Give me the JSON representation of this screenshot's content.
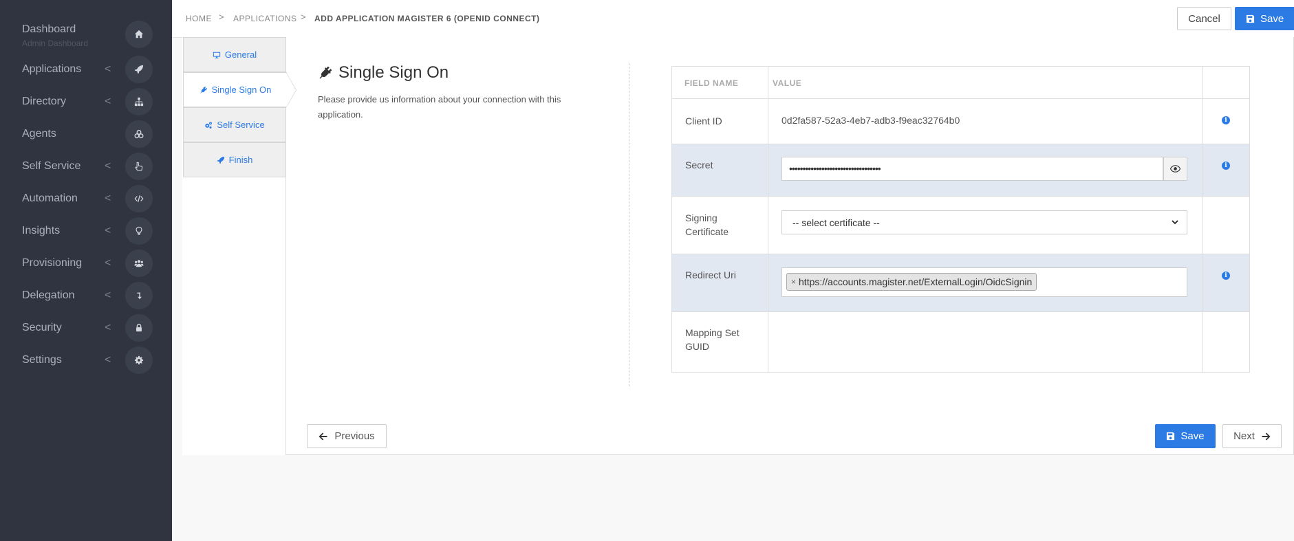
{
  "sidebar": {
    "items": [
      {
        "label": "Dashboard",
        "sublabel": "Admin Dashboard",
        "icon": "home-icon",
        "chevron": false
      },
      {
        "label": "Applications",
        "icon": "rocket-icon",
        "chevron": true
      },
      {
        "label": "Directory",
        "icon": "sitemap-icon",
        "chevron": true
      },
      {
        "label": "Agents",
        "icon": "cubes-icon",
        "chevron": false
      },
      {
        "label": "Self Service",
        "icon": "hand-pointer-icon",
        "chevron": true
      },
      {
        "label": "Automation",
        "icon": "code-icon",
        "chevron": true
      },
      {
        "label": "Insights",
        "icon": "lightbulb-icon",
        "chevron": true
      },
      {
        "label": "Provisioning",
        "icon": "users-icon",
        "chevron": true
      },
      {
        "label": "Delegation",
        "icon": "level-down-icon",
        "chevron": true
      },
      {
        "label": "Security",
        "icon": "lock-icon",
        "chevron": true
      },
      {
        "label": "Settings",
        "icon": "gear-icon",
        "chevron": true
      }
    ],
    "chevron_glyph": "<"
  },
  "breadcrumb": {
    "home": "HOME",
    "applications": "APPLICATIONS",
    "current": "ADD APPLICATION MAGISTER 6 (OPENID CONNECT)",
    "sep": ">"
  },
  "toolbar": {
    "cancel_label": "Cancel",
    "save_label": "Save"
  },
  "steps": [
    {
      "label": "General",
      "icon": "desktop-icon"
    },
    {
      "label": "Single Sign On",
      "icon": "plug-icon",
      "active": true
    },
    {
      "label": "Self Service",
      "icon": "cogs-icon"
    },
    {
      "label": "Finish",
      "icon": "rocket-icon"
    }
  ],
  "section": {
    "title": "Single Sign On",
    "description": "Please provide us information about your connection with this application."
  },
  "table": {
    "headers": {
      "name": "FIELD NAME",
      "value": "VALUE"
    },
    "rows": {
      "client_id": {
        "label": "Client ID",
        "value": "0d2fa587-52a3-4eb7-adb3-f9eac32764b0"
      },
      "secret": {
        "label": "Secret",
        "value": "••••••••••••••••••••••••••••••••••"
      },
      "signing": {
        "label": "Signing Certificate",
        "selected": "-- select certificate --"
      },
      "redirect": {
        "label": "Redirect Uri",
        "tag": "https://accounts.magister.net/ExternalLogin/OidcSignin",
        "tag_remove": "×"
      },
      "mapping": {
        "label": "Mapping Set GUID"
      }
    },
    "info_glyph": "i"
  },
  "footer": {
    "previous_label": "Previous",
    "save_label": "Save",
    "next_label": "Next"
  },
  "colors": {
    "accent": "#2c7be5",
    "sidebar_bg": "#2f3440",
    "row_alt": "#e1e8f2"
  }
}
